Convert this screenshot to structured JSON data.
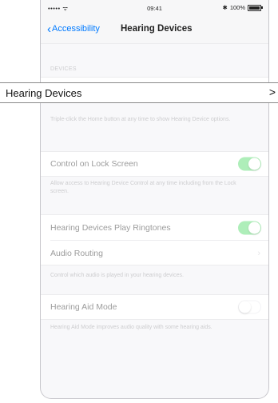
{
  "status_bar": {
    "signal": "••••• ",
    "wifi_icon": "wifi-icon",
    "time": "09:41",
    "bluetooth": "✱",
    "battery_label": "100%"
  },
  "nav": {
    "back_label": "Accessibility",
    "title": "Hearing Devices"
  },
  "sections": {
    "devices_header": "DEVICES",
    "triple_click_footer": "Triple-click the Home button at any time to show Hearing Device options.",
    "lock_screen_label": "Control on Lock Screen",
    "lock_screen_footer": "Allow access to Hearing Device Control at any time including from the Lock screen.",
    "ringtones_label": "Hearing Devices Play Ringtones",
    "audio_routing_label": "Audio Routing",
    "audio_routing_footer": "Control which audio is played in your hearing devices.",
    "hearing_aid_mode_label": "Hearing Aid Mode",
    "hearing_aid_mode_footer": "Hearing Aid Mode improves audio quality with some hearing aids."
  },
  "toggles": {
    "lock_screen": true,
    "ringtones": true,
    "hearing_aid_mode": false
  },
  "callout": {
    "label": "Hearing Devices",
    "arrow": ">"
  },
  "colors": {
    "accent": "#007aff",
    "toggle_on": "#4cd964"
  }
}
